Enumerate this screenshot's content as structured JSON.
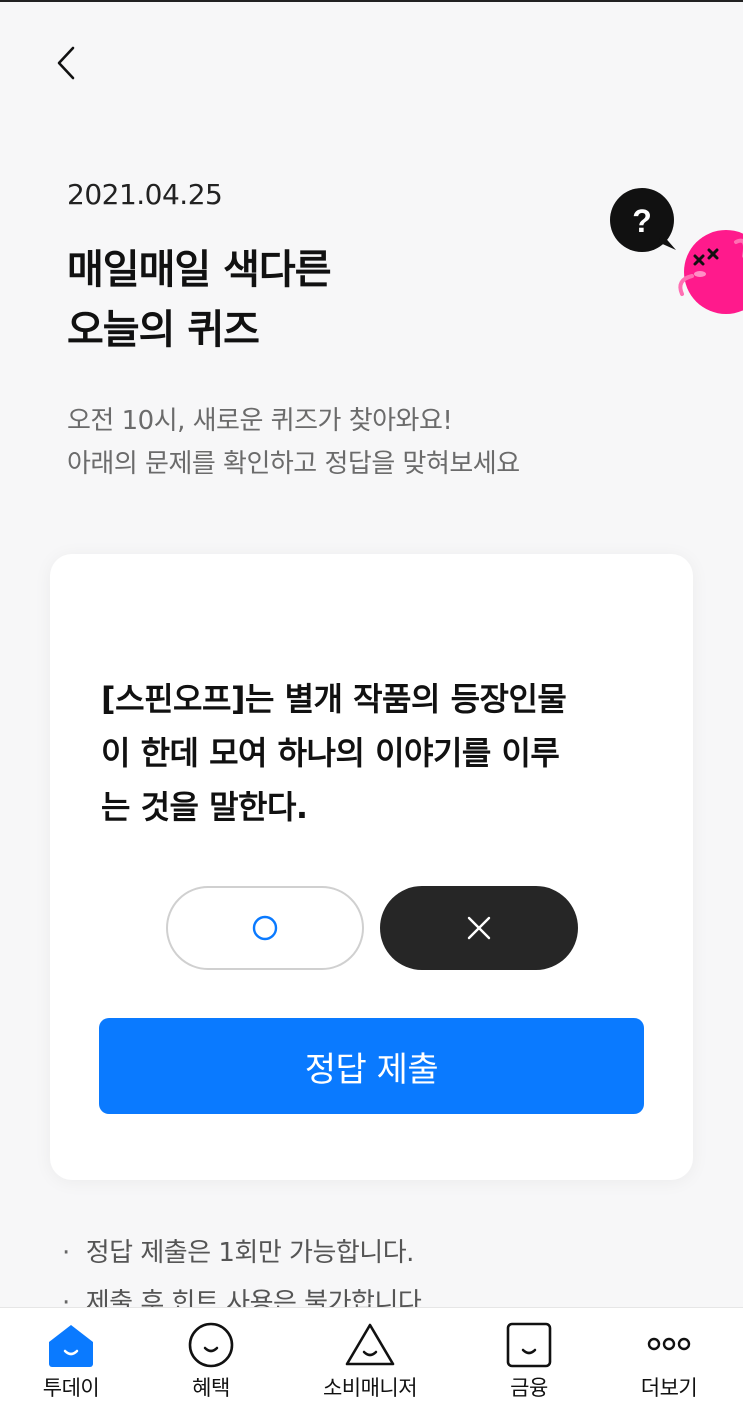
{
  "header": {
    "back_icon": "chevron-left-icon",
    "date": "2021.04.25",
    "title_line1": "매일매일 색다른",
    "title_line2": "오늘의 퀴즈",
    "subtitle_line1": "오전 10시, 새로운 퀴즈가 찾아와요!",
    "subtitle_line2": "아래의 문제를 확인하고 정답을 맞혀보세요",
    "mascot_bubble_text": "?"
  },
  "quiz": {
    "question_line1": "[스핀오프]는 별개 작품의 등장인물",
    "question_line2": "이 한데 모여 하나의 이야기를 이루",
    "question_line3": "는 것을 말한다.",
    "option_o_icon": "circle-o-icon",
    "option_x_icon": "x-mark-icon",
    "selected_option": "X",
    "submit_label": "정답 제출"
  },
  "notes": [
    "정답 제출은 1회만 가능합니다.",
    "제출 후 힌트 사용은 불가합니다."
  ],
  "tabbar": {
    "items": [
      {
        "label": "투데이",
        "icon": "home-icon",
        "active": true
      },
      {
        "label": "혜택",
        "icon": "smile-circle-icon",
        "active": false
      },
      {
        "label": "소비매니저",
        "icon": "triangle-face-icon",
        "active": false
      },
      {
        "label": "금융",
        "icon": "square-face-icon",
        "active": false
      },
      {
        "label": "더보기",
        "icon": "more-dots-icon",
        "active": false
      }
    ]
  },
  "colors": {
    "accent": "#0a7aff",
    "selected_button": "#262626",
    "mascot_pink": "#ff1a8c",
    "background": "#f7f7f8"
  }
}
